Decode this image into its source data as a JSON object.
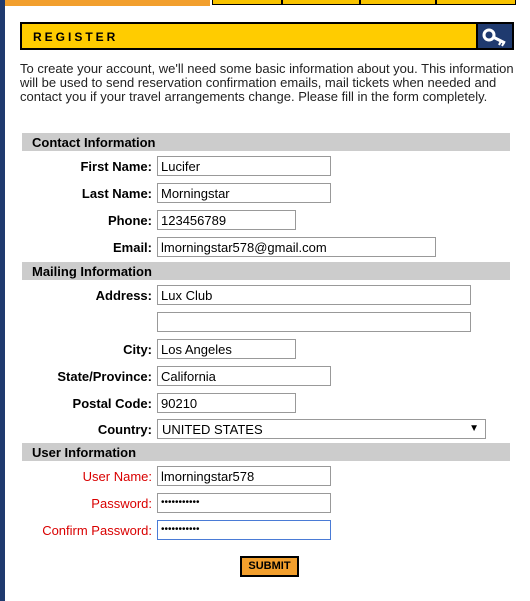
{
  "header": {
    "title": "REGISTER",
    "icon": "key-icon"
  },
  "intro": "To create your account, we'll need some basic information about you. This information will be used to send reservation confirmation emails, mail tickets when needed and contact you if your travel arrangements change. Please fill in the form completely.",
  "sections": {
    "contact": "Contact Information",
    "mailing": "Mailing Information",
    "user": "User Information"
  },
  "contact": {
    "first_name": {
      "label": "First Name:",
      "value": "Lucifer"
    },
    "last_name": {
      "label": "Last Name:",
      "value": "Morningstar"
    },
    "phone": {
      "label": "Phone:",
      "value": "123456789"
    },
    "email": {
      "label": "Email:",
      "value": "lmorningstar578@gmail.com"
    }
  },
  "mailing": {
    "address": {
      "label": "Address:",
      "value": "Lux Club",
      "value2": ""
    },
    "city": {
      "label": "City:",
      "value": "Los Angeles"
    },
    "state": {
      "label": "State/Province:",
      "value": "California"
    },
    "postal": {
      "label": "Postal Code:",
      "value": "90210"
    },
    "country": {
      "label": "Country:",
      "value": "UNITED STATES"
    }
  },
  "user": {
    "username": {
      "label": "User Name:",
      "value": "lmorningstar578"
    },
    "password": {
      "label": "Password:",
      "value": "•••••••••••"
    },
    "confirm": {
      "label": "Confirm Password:",
      "value": "•••••••••••"
    }
  },
  "submit_label": "SUBMIT",
  "colors": {
    "accent": "#ffcc00",
    "navy": "#1f3a6f",
    "orange": "#f29f2d",
    "required": "#d90000"
  }
}
